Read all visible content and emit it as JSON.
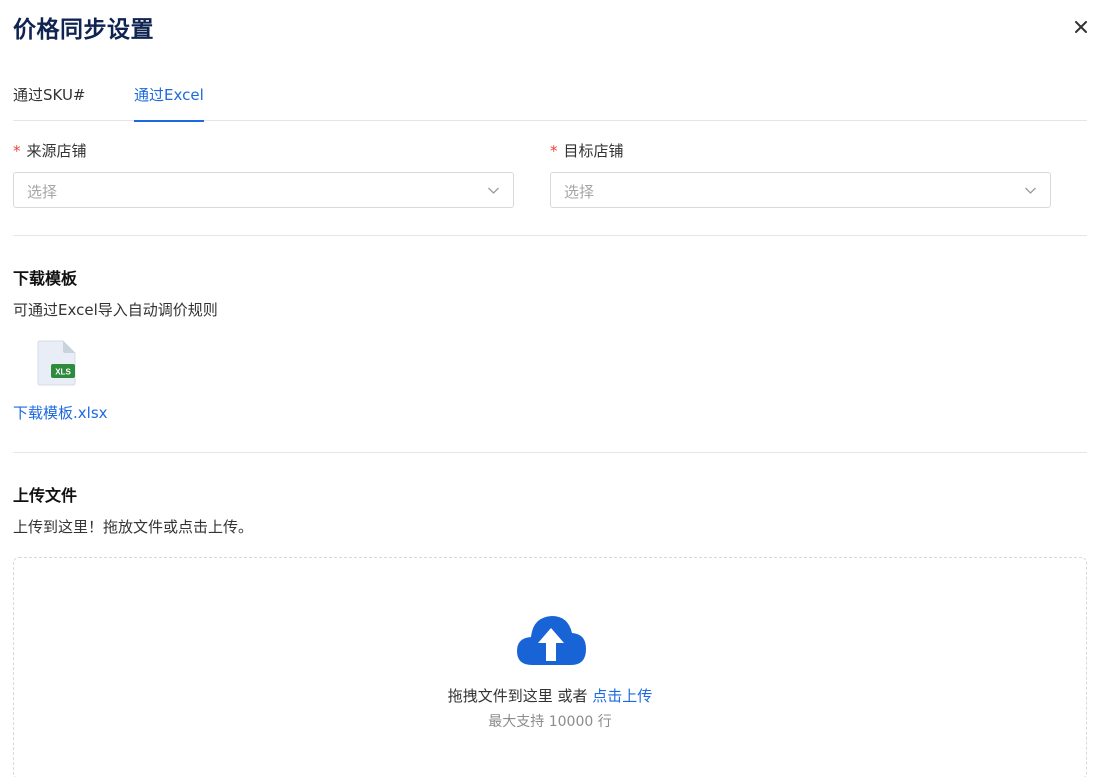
{
  "dialog": {
    "title": "价格同步设置",
    "close_icon": "close-icon"
  },
  "tabs": [
    {
      "label": "通过SKU#",
      "active": false
    },
    {
      "label": "通过Excel",
      "active": true
    }
  ],
  "form": {
    "source": {
      "required_mark": "*",
      "label": "来源店铺",
      "placeholder": "选择"
    },
    "target": {
      "required_mark": "*",
      "label": "目标店铺",
      "placeholder": "选择"
    }
  },
  "download": {
    "title": "下载模板",
    "description": "可通过Excel导入自动调价规则",
    "file_icon_badge": "XLS",
    "file_name": "下载模板.xlsx"
  },
  "upload": {
    "title": "上传文件",
    "description": "上传到这里！拖放文件或点击上传。",
    "drop_text": "拖拽文件到这里 或者",
    "click_text": "点击上传",
    "limit_text": "最大支持 10000 行",
    "icon": "cloud-upload-icon"
  },
  "colors": {
    "title": "#0f2451",
    "accent": "#1d6ae0",
    "required": "#e8453c",
    "excel_green": "#2e8b3e"
  }
}
